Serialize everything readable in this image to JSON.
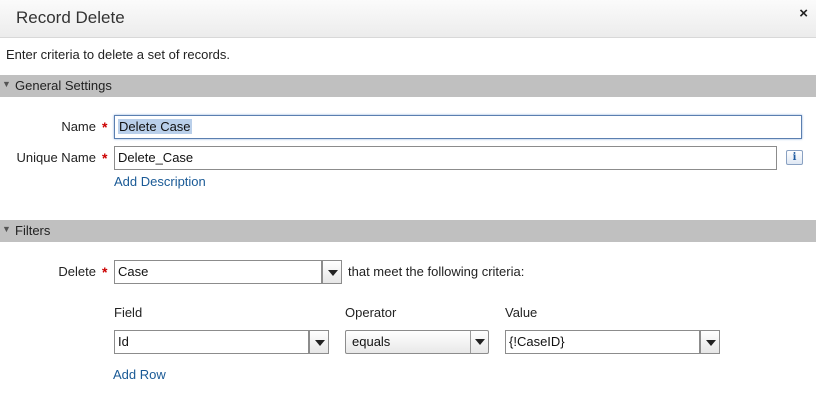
{
  "dialog": {
    "title": "Record Delete",
    "close_glyph": "×",
    "intro": "Enter criteria to delete a set of records."
  },
  "general": {
    "section_label": "General Settings",
    "name_label": "Name",
    "name_value": "Delete Case",
    "unique_name_label": "Unique Name",
    "unique_name_value": "Delete_Case",
    "info_glyph": "i",
    "add_description": "Add Description"
  },
  "filters": {
    "section_label": "Filters",
    "delete_label": "Delete",
    "object_value": "Case",
    "criteria_text": "that meet the following criteria:",
    "columns": {
      "field": "Field",
      "operator": "Operator",
      "value": "Value"
    },
    "row": {
      "field": "Id",
      "operator": "equals",
      "value": "{!CaseID}"
    },
    "add_row": "Add Row"
  },
  "required_marker": "*",
  "colors": {
    "section_bg": "#c0c0c0",
    "link": "#1a5a96",
    "required": "#cc0000",
    "selection": "#b9cfea"
  },
  "icons": {
    "close": "close-icon",
    "collapse": "collapse-triangle-icon",
    "info": "info-icon",
    "dropdown": "chevron-down-icon"
  }
}
